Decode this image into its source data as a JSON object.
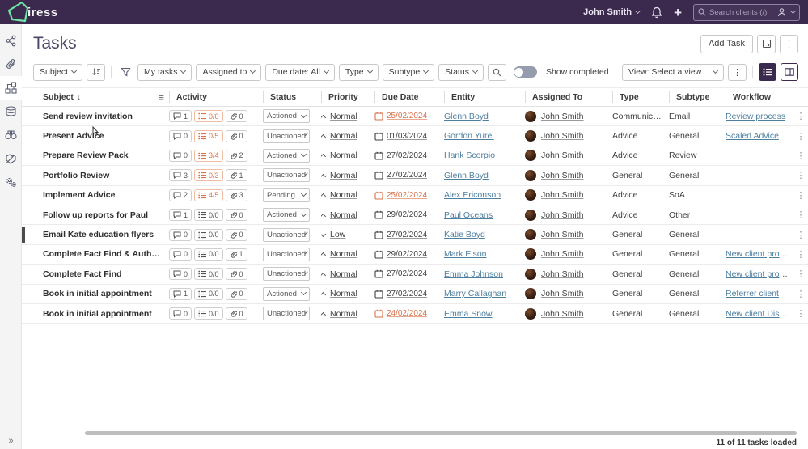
{
  "topbar": {
    "logo_text": "iress",
    "user_name": "John Smith",
    "search_placeholder": "Search clients (/)",
    "icons": [
      "notification-bell-icon",
      "quick-add-plus-icon",
      "search-icon",
      "person-icon"
    ]
  },
  "sidebar": {
    "items": [
      {
        "icon": "network-icon"
      },
      {
        "icon": "link-icon"
      },
      {
        "icon": "workflow-icon",
        "active": true
      },
      {
        "icon": "coins-icon"
      },
      {
        "icon": "binoculars-icon"
      },
      {
        "icon": "deals-icon"
      },
      {
        "icon": "settings-gears-icon"
      }
    ],
    "expand_glyph": "»"
  },
  "page": {
    "title": "Tasks",
    "add_task_label": "Add Task"
  },
  "filters": {
    "subject": "Subject",
    "my_tasks": "My tasks",
    "assigned_to": "Assigned to",
    "due_date": "Due date: All",
    "type": "Type",
    "subtype": "Subtype",
    "status": "Status",
    "show_completed": "Show completed",
    "show_completed_on": false,
    "view_select": "View: Select a view"
  },
  "table": {
    "columns": [
      "Subject",
      "Activity",
      "Status",
      "Priority",
      "Due Date",
      "Entity",
      "Assigned To",
      "Type",
      "Subtype",
      "Workflow"
    ],
    "rows": [
      {
        "subject": "Send review invitation",
        "comments": "1",
        "checklist": "0/0",
        "checklist_alert": true,
        "links": "0",
        "status": "Actioned",
        "priority": "Normal",
        "priority_dir": "up",
        "due_date": "25/02/2024",
        "overdue": true,
        "entity": "Glenn Boyd",
        "assigned_to": "John Smith",
        "type": "Communicati...",
        "subtype": "Email",
        "workflow": "Review process"
      },
      {
        "subject": "Present Advice",
        "comments": "0",
        "checklist": "0/5",
        "checklist_alert": true,
        "links": "0",
        "status": "Unactioned",
        "priority": "Normal",
        "priority_dir": "up",
        "due_date": "01/03/2024",
        "overdue": false,
        "entity": "Gordon Yurel",
        "assigned_to": "John Smith",
        "type": "Advice",
        "subtype": "General",
        "workflow": "Scaled Advice"
      },
      {
        "subject": "Prepare Review Pack",
        "comments": "0",
        "checklist": "3/4",
        "checklist_alert": true,
        "links": "2",
        "status": "Actioned",
        "priority": "Normal",
        "priority_dir": "up",
        "due_date": "27/02/2024",
        "overdue": false,
        "entity": "Hank Scorpio",
        "assigned_to": "John Smith",
        "type": "Advice",
        "subtype": "Review",
        "workflow": ""
      },
      {
        "subject": "Portfolio Review",
        "comments": "3",
        "checklist": "0/3",
        "checklist_alert": true,
        "links": "1",
        "status": "Unactioned",
        "priority": "Normal",
        "priority_dir": "up",
        "due_date": "27/02/2024",
        "overdue": false,
        "entity": "Glenn Boyd",
        "assigned_to": "John Smith",
        "type": "General",
        "subtype": "General",
        "workflow": ""
      },
      {
        "subject": "Implement Advice",
        "comments": "2",
        "checklist": "4/5",
        "checklist_alert": true,
        "links": "3",
        "status": "Pending",
        "priority": "Normal",
        "priority_dir": "up",
        "due_date": "25/02/2024",
        "overdue": true,
        "entity": "Alex Ericonson",
        "assigned_to": "John Smith",
        "type": "Advice",
        "subtype": "SoA",
        "workflow": ""
      },
      {
        "subject": "Follow up reports for Paul",
        "comments": "1",
        "checklist": "0/0",
        "checklist_alert": false,
        "links": "0",
        "status": "Actioned",
        "priority": "Normal",
        "priority_dir": "up",
        "due_date": "29/02/2024",
        "overdue": false,
        "entity": "Paul Oceans",
        "assigned_to": "John Smith",
        "type": "Advice",
        "subtype": "Other",
        "workflow": ""
      },
      {
        "subject": "Email Kate education flyers",
        "selected": true,
        "comments": "0",
        "checklist": "0/0",
        "checklist_alert": false,
        "links": "0",
        "status": "Unactioned",
        "priority": "Low",
        "priority_dir": "down",
        "due_date": "27/02/2024",
        "overdue": false,
        "entity": "Katie Boyd",
        "assigned_to": "John Smith",
        "type": "General",
        "subtype": "General",
        "workflow": ""
      },
      {
        "subject": "Complete Fact Find & Authorities",
        "comments": "0",
        "checklist": "0/0",
        "checklist_alert": false,
        "links": "1",
        "status": "Unactioned",
        "priority": "Normal",
        "priority_dir": "up",
        "due_date": "29/02/2024",
        "overdue": false,
        "entity": "Mark Elson",
        "assigned_to": "John Smith",
        "type": "General",
        "subtype": "General",
        "workflow": "New client process"
      },
      {
        "subject": "Complete Fact Find",
        "comments": "0",
        "checklist": "0/0",
        "checklist_alert": false,
        "links": "0",
        "status": "Unactioned",
        "priority": "Normal",
        "priority_dir": "up",
        "due_date": "27/02/2024",
        "overdue": false,
        "entity": "Emma Johnson",
        "assigned_to": "John Smith",
        "type": "General",
        "subtype": "General",
        "workflow": "New client process"
      },
      {
        "subject": "Book in initial appointment",
        "comments": "1",
        "checklist": "0/0",
        "checklist_alert": false,
        "links": "0",
        "status": "Actioned",
        "priority": "Normal",
        "priority_dir": "up",
        "due_date": "27/02/2024",
        "overdue": false,
        "entity": "Marry Callaghan",
        "assigned_to": "John Smith",
        "type": "General",
        "subtype": "General",
        "workflow": "Referrer client"
      },
      {
        "subject": "Book in initial appointment",
        "comments": "0",
        "checklist": "0/0",
        "checklist_alert": false,
        "links": "0",
        "status": "Unactioned",
        "priority": "Normal",
        "priority_dir": "up",
        "due_date": "24/02/2024",
        "overdue": true,
        "entity": "Emma Snow",
        "assigned_to": "John Smith",
        "type": "General",
        "subtype": "General",
        "workflow": "New client Discov..."
      }
    ]
  },
  "footer": {
    "status_text": "11 of 11 tasks loaded"
  },
  "colors": {
    "topbar_bg": "#3b2a4e",
    "brand_green": "#6fe3a5",
    "link_blue": "#4e7f9e",
    "overdue_orange": "#d9714b",
    "active_view_bg": "#3b2a4e"
  }
}
